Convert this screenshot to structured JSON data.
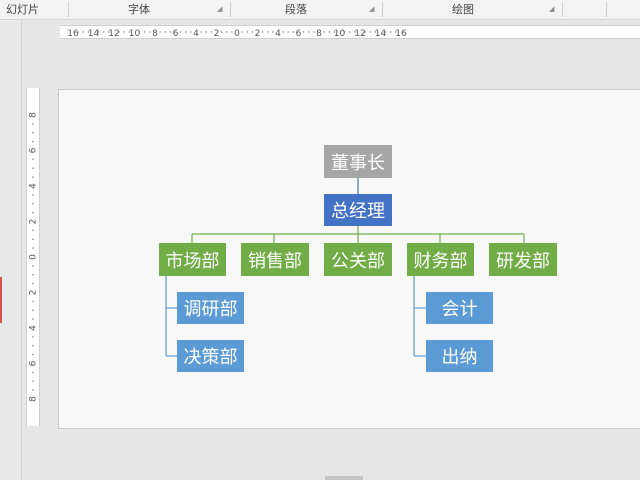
{
  "ribbon": {
    "groups": [
      "幻灯片",
      "字体",
      "段落",
      "绘图"
    ],
    "launcher_icon": "dialog-launcher-icon"
  },
  "ruler": {
    "horizontal_ticks": [
      "16",
      "14",
      "12",
      "10",
      "8",
      "6",
      "4",
      "2",
      "0",
      "2",
      "4",
      "6",
      "8",
      "10",
      "12",
      "14",
      "16"
    ],
    "vertical_ticks": [
      "8",
      "6",
      "4",
      "2",
      "0",
      "2",
      "4",
      "6",
      "8"
    ]
  },
  "org_chart": {
    "chairman": "董事长",
    "general_manager": "总经理",
    "departments": [
      "市场部",
      "销售部",
      "公关部",
      "财务部",
      "研发部"
    ],
    "market_sub": [
      "调研部",
      "决策部"
    ],
    "finance_sub": [
      "会计",
      "出纳"
    ]
  },
  "colors": {
    "chairman": "#a6a6a6",
    "manager": "#4472c4",
    "department": "#70ad47",
    "sub_department": "#5b9bd5",
    "connector_green": "#70ad47",
    "connector_blue": "#5b9bd5"
  }
}
